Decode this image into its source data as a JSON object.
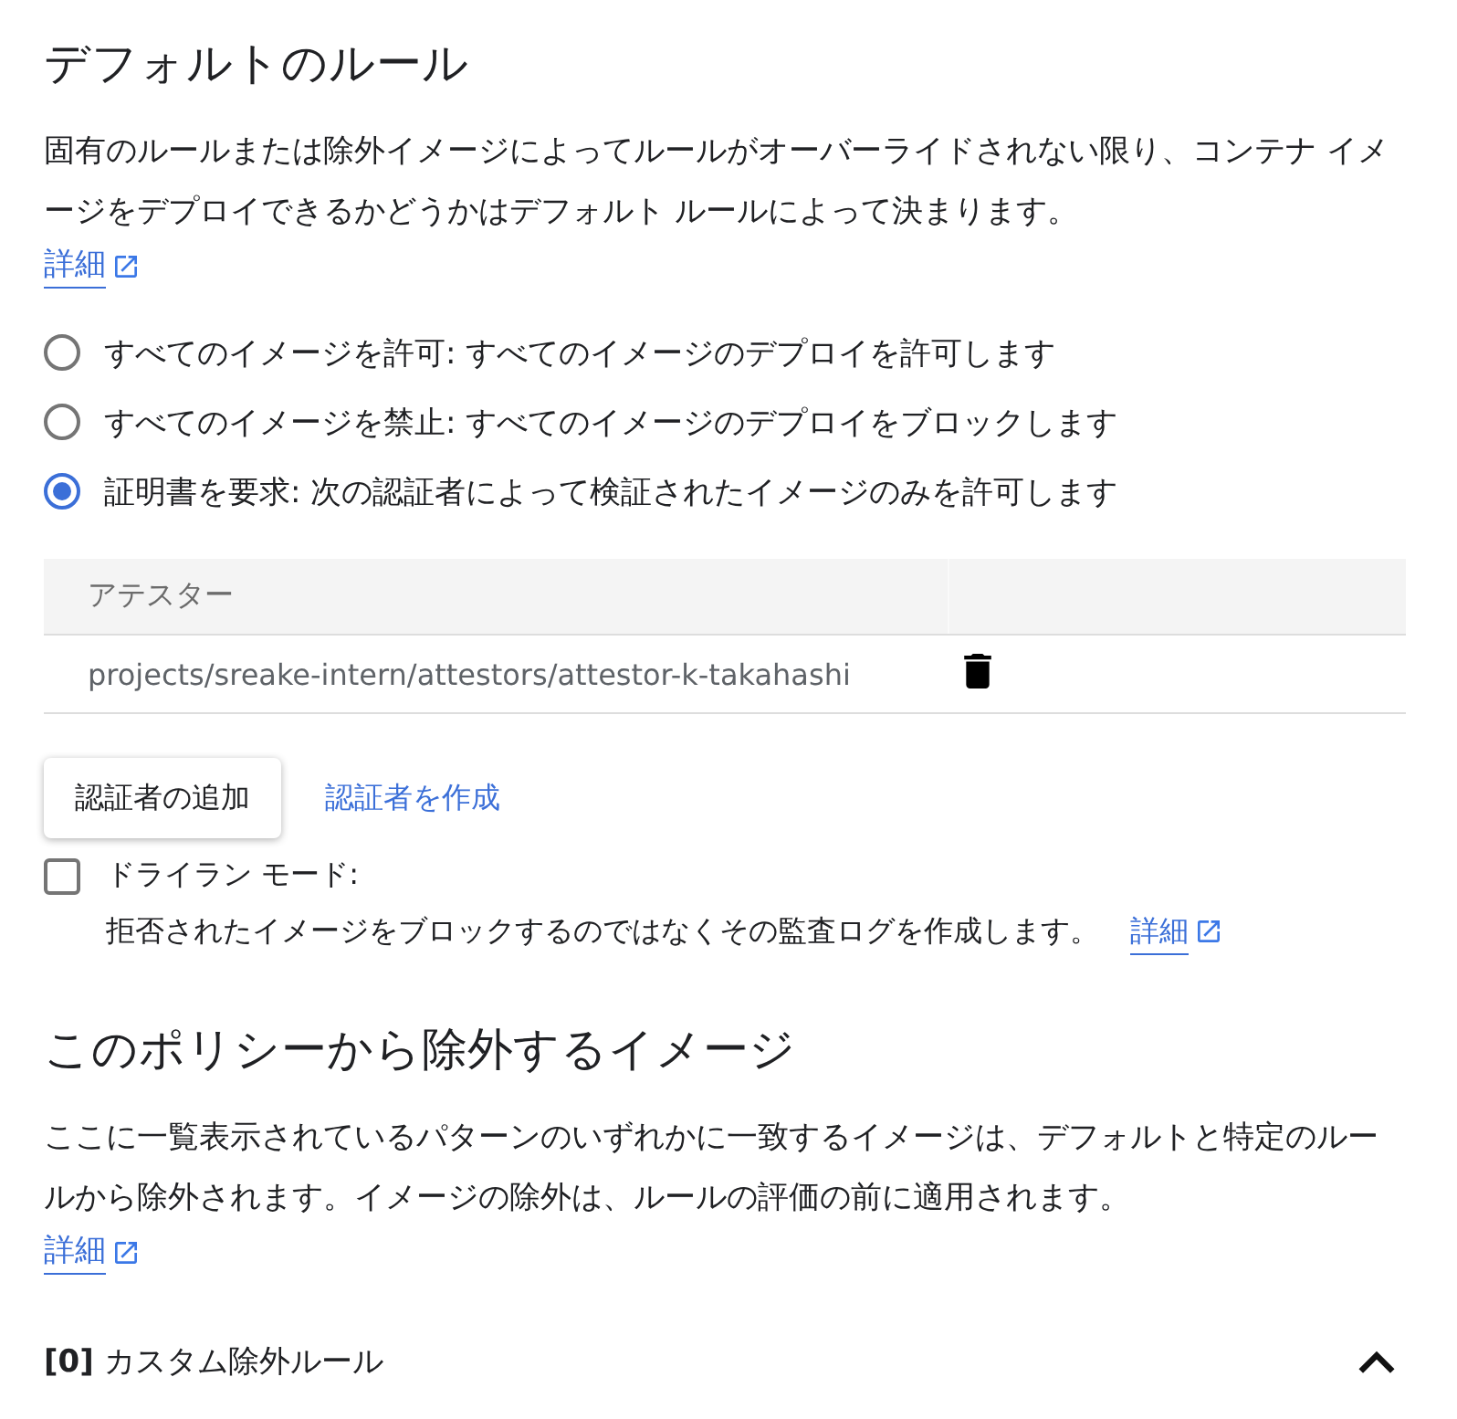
{
  "default_rule": {
    "title": "デフォルトのルール",
    "description": "固有のルールまたは除外イメージによってルールがオーバーライドされない限り、コンテナ イメージをデプロイできるかどうかはデフォルト ルールによって決まります。",
    "details_link": "詳細",
    "options": [
      {
        "label": "すべてのイメージを許可: すべてのイメージのデプロイを許可します",
        "selected": false
      },
      {
        "label": "すべてのイメージを禁止: すべてのイメージのデプロイをブロックします",
        "selected": false
      },
      {
        "label": "証明書を要求: 次の認証者によって検証されたイメージのみを許可します",
        "selected": true
      }
    ],
    "attestors_table": {
      "columns": [
        "アテスター"
      ],
      "rows": [
        {
          "name": "projects/sreake-intern/attestors/attestor-k-takahashi"
        }
      ]
    },
    "add_button": "認証者の追加",
    "create_link": "認証者を作成",
    "dry_run": {
      "label": "ドライラン モード:",
      "checked": false,
      "description": "拒否されたイメージをブロックするのではなくその監査ログを作成します。",
      "details_link": "詳細"
    }
  },
  "exempt_images": {
    "title": "このポリシーから除外するイメージ",
    "description": "ここに一覧表示されているパターンのいずれかに一致するイメージは、デフォルトと特定のルールから除外されます。イメージの除外は、ルールの評価の前に適用されます。",
    "details_link": "詳細",
    "panel": {
      "title": "**[0]** カスタム除外ルール",
      "expanded": true
    }
  }
}
